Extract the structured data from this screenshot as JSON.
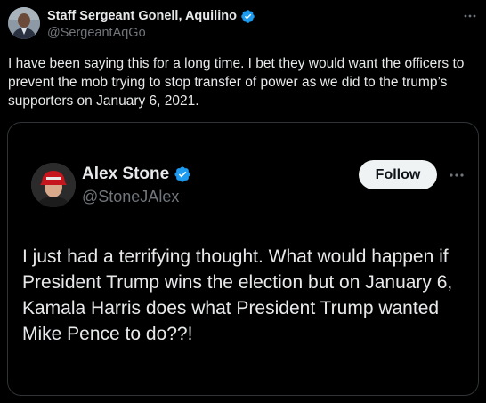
{
  "post": {
    "author_name": "Staff Sergeant Gonell, Aquilino",
    "author_handle": "@SergeantAqGo",
    "text": "I have been saying this for a long time. I bet they would want the officers to prevent the mob trying to stop transfer of power as we did to the trump’s supporters on January 6, 2021.",
    "verified_icon": "verified-badge-icon",
    "more_icon": "more-options-icon"
  },
  "quoted_post": {
    "author_name": "Alex Stone",
    "author_handle": "@StoneJAlex",
    "follow_label": "Follow",
    "text": "I just had a terrifying thought. What would happen if President Trump wins the election but on January 6, Kamala Harris does what President Trump wanted Mike Pence to do??!",
    "verified_icon": "verified-badge-icon",
    "more_icon": "more-options-icon"
  },
  "colors": {
    "background": "#000000",
    "primary_text": "#e7e9ea",
    "secondary_text": "#71767b",
    "verified_blue": "#1d9bf0",
    "border": "#2f3336",
    "follow_button_bg": "#eff3f4"
  }
}
